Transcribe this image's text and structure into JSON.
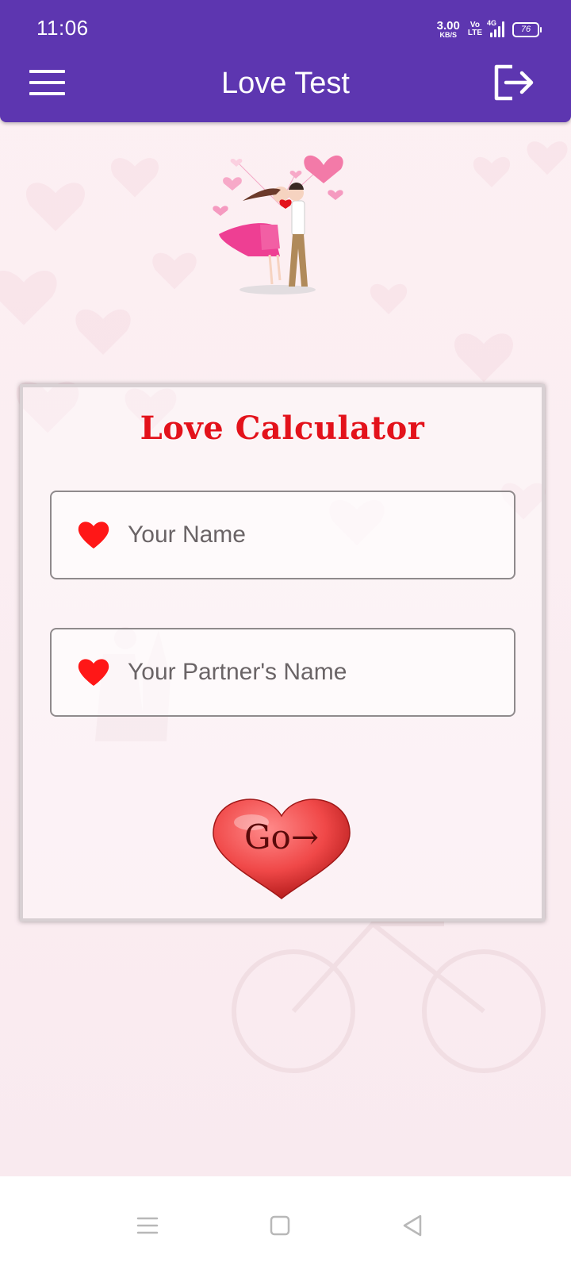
{
  "status_bar": {
    "time": "11:06",
    "net_speed_value": "3.00",
    "net_speed_unit": "KB/S",
    "volte_top": "Vo",
    "volte_bottom": "LTE",
    "network_label": "4G",
    "battery_level": "76"
  },
  "app_bar": {
    "title": "Love Test",
    "menu_icon": "hamburger-menu-icon",
    "logout_icon": "logout-icon"
  },
  "card": {
    "title": "Love Calculator",
    "fields": [
      {
        "placeholder": "Your Name",
        "value": "",
        "icon": "heart-icon"
      },
      {
        "placeholder": "Your Partner's Name",
        "value": "",
        "icon": "heart-icon"
      }
    ],
    "go_button": {
      "label": "Go→"
    }
  },
  "colors": {
    "app_bar": "#5d36b0",
    "accent_red": "#e3121b",
    "heart_red": "#ff1717",
    "background": "#fbeef2"
  },
  "nav_bar": {
    "icons": [
      "recent-apps-icon",
      "home-icon",
      "back-icon"
    ]
  }
}
